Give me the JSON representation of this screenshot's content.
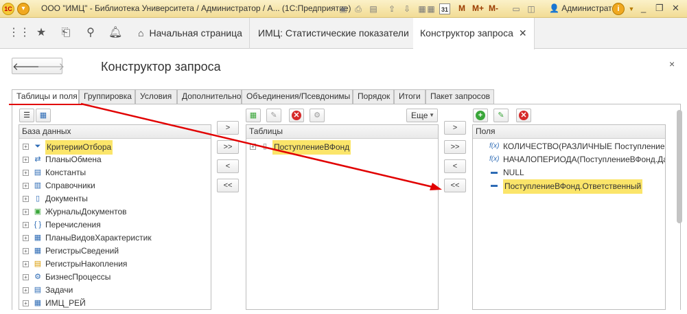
{
  "titlebar": {
    "logo": "1С",
    "title": "ООО \"ИМЦ\" - Библиотека Университета / Администратор / А... (1С:Предприятие)",
    "m1": "M",
    "m2": "M+",
    "m3": "M-",
    "user": "Администратор",
    "info": "i",
    "icons": [
      "save-icon",
      "print-icon",
      "preview-icon",
      "upload-icon",
      "download-icon",
      "compare-icon",
      "calculator-icon",
      "calendar-icon",
      "panels-icon",
      "user-icon",
      "minimize-icon",
      "restore-icon",
      "close-icon"
    ],
    "calendar": "31"
  },
  "nav": {
    "tabs": [
      {
        "label": "Начальная страница"
      },
      {
        "label": "ИМЦ: Статистические показатели"
      },
      {
        "label": "Конструктор запроса",
        "active": true
      }
    ],
    "close": "✕"
  },
  "form": {
    "title": "Конструктор запроса",
    "close": "×"
  },
  "tabs": [
    {
      "label": "Таблицы и поля",
      "active": true
    },
    {
      "label": "Группировка"
    },
    {
      "label": "Условия"
    },
    {
      "label": "Дополнительно"
    },
    {
      "label": "Объединения/Псевдонимы"
    },
    {
      "label": "Порядок"
    },
    {
      "label": "Итоги"
    },
    {
      "label": "Пакет запросов"
    }
  ],
  "database": {
    "header": "База данных",
    "items": [
      {
        "label": "КритерииОтбора",
        "icon": "filter-icon",
        "highlighted": true
      },
      {
        "label": "ПланыОбмена",
        "icon": "exchange-icon"
      },
      {
        "label": "Константы",
        "icon": "constant-icon"
      },
      {
        "label": "Справочники",
        "icon": "catalog-icon"
      },
      {
        "label": "Документы",
        "icon": "document-icon"
      },
      {
        "label": "ЖурналыДокументов",
        "icon": "journal-icon"
      },
      {
        "label": "Перечисления",
        "icon": "enum-icon"
      },
      {
        "label": "ПланыВидовХарактеристик",
        "icon": "chart-of-characteristics-icon"
      },
      {
        "label": "РегистрыСведений",
        "icon": "info-register-icon"
      },
      {
        "label": "РегистрыНакопления",
        "icon": "accumulation-register-icon"
      },
      {
        "label": "БизнесПроцессы",
        "icon": "business-process-icon"
      },
      {
        "label": "Задачи",
        "icon": "task-icon"
      },
      {
        "label": "ИМЦ_РЕЙ",
        "icon": "table-icon"
      }
    ]
  },
  "tables": {
    "header": "Таблицы",
    "more": "Еще",
    "items": [
      {
        "label": "ПоступлениеВФонд",
        "highlighted": true
      }
    ]
  },
  "fields": {
    "header": "Поля",
    "items": [
      {
        "label": "КОЛИЧЕСТВО(РАЗЛИЧНЫЕ ПоступлениеВФонд",
        "icon": "f(x)"
      },
      {
        "label": "НАЧАЛОПЕРИОДА(ПоступлениеВФонд.Дата",
        "icon": "f(x)"
      },
      {
        "label": "NULL",
        "icon": "field-icon"
      },
      {
        "label": "ПоступлениеВФонд.Ответственный",
        "icon": "field-icon",
        "highlighted": true
      }
    ]
  },
  "arrows": {
    "add": ">",
    "add_all": ">>",
    "remove": "<",
    "remove_all": "<<"
  },
  "accent_colors": {
    "annotation": "#e10000",
    "highlight": "#fbe56a",
    "add_green": "#3aa63a",
    "delete_red": "#d62a2a"
  }
}
